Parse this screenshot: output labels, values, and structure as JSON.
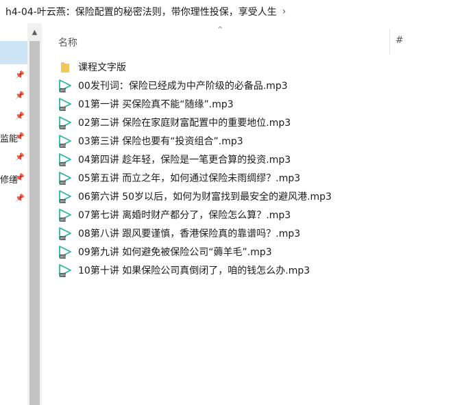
{
  "breadcrumb": {
    "path": "h4-04-叶云燕：保险配置的秘密法则，带你理性投保，享受人生",
    "chevron": "›"
  },
  "nav": {
    "items": [
      {
        "label": ""
      },
      {
        "label": ""
      },
      {
        "label": ""
      },
      {
        "label": ""
      },
      {
        "label": "监能"
      },
      {
        "label": ""
      },
      {
        "label": "修缮"
      },
      {
        "label": ""
      }
    ],
    "pin_glyph": "📌"
  },
  "header": {
    "sort_indicator": "^",
    "name_column": "名称",
    "number_column": "#"
  },
  "files": [
    {
      "name": "课程文字版",
      "type": "folder"
    },
    {
      "name": "00发刊词：保险已经成为中产阶级的必备品.mp3",
      "type": "mp3"
    },
    {
      "name": "01第一讲 买保险真不能“随缘”.mp3",
      "type": "mp3"
    },
    {
      "name": "02第二讲 保险在家庭财富配置中的重要地位.mp3",
      "type": "mp3"
    },
    {
      "name": "03第三讲 保险也要有“投资组合”.mp3",
      "type": "mp3"
    },
    {
      "name": "04第四讲 趁年轻，保险是一笔更合算的投资.mp3",
      "type": "mp3"
    },
    {
      "name": "05第五讲 而立之年，如何通过保险未雨绸缪？.mp3",
      "type": "mp3"
    },
    {
      "name": "06第六讲 50岁以后，如何为财富找到最安全的避风港.mp3",
      "type": "mp3"
    },
    {
      "name": "07第七讲 离婚时财产都分了，保险怎么算？.mp3",
      "type": "mp3"
    },
    {
      "name": "08第八讲 跟风要谨慎，香港保险真的靠谱吗？.mp3",
      "type": "mp3"
    },
    {
      "name": "09第九讲 如何避免被保险公司“薅羊毛”.mp3",
      "type": "mp3"
    },
    {
      "name": "10第十讲 如果保险公司真倒闭了，咱的钱怎么办.mp3",
      "type": "mp3"
    }
  ],
  "colors": {
    "selection": "#cde4f7",
    "folder": "#f2c55c",
    "mp3_play": "#2bb5a6"
  }
}
